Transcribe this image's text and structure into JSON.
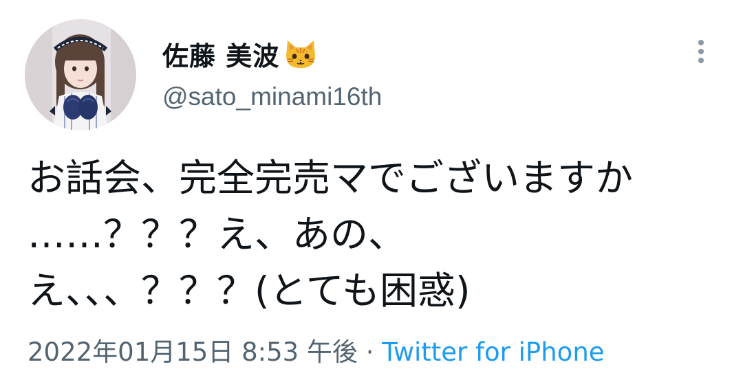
{
  "tweet": {
    "display_name": "佐藤 美波",
    "name_emoji": "cat-face-icon",
    "handle": "@sato_minami16th",
    "text_lines": [
      "お話会、完全完売マでございますか",
      "……？？？え、あの、",
      "え、、、？？？(とても困惑)"
    ],
    "timestamp": "2022年01月15日 8:53 午後",
    "separator": " · ",
    "source": "Twitter for iPhone"
  },
  "icons": {
    "more_menu": "more-vertical-icon",
    "avatar": "profile-photo"
  },
  "colors": {
    "text": "#0f1419",
    "secondary": "#536471",
    "link": "#1d9bf0",
    "menu_dots": "#8b98a5"
  }
}
